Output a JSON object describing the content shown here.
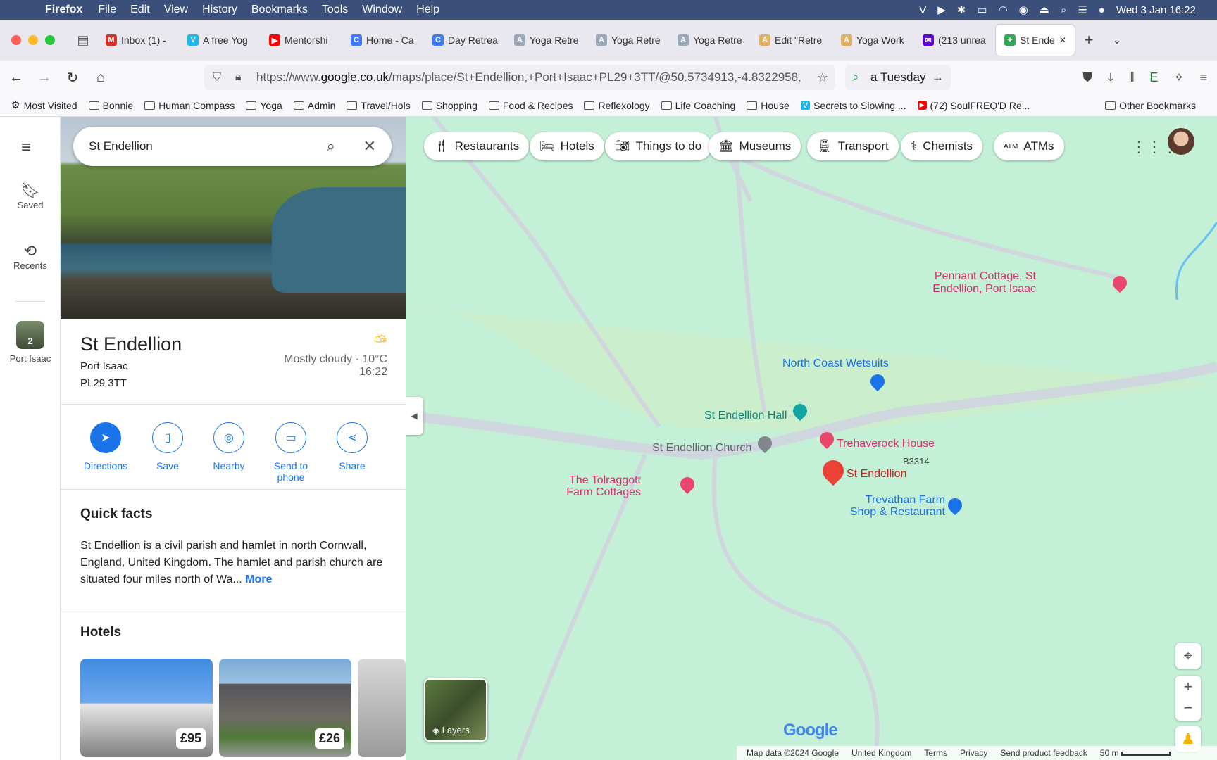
{
  "menubar": {
    "app": "Firefox",
    "items": [
      "File",
      "Edit",
      "View",
      "History",
      "Bookmarks",
      "Tools",
      "Window",
      "Help"
    ],
    "clock": "Wed 3 Jan  16:22"
  },
  "tabs": [
    {
      "label": "Inbox (1) -",
      "color": "#d93025",
      "icon": "M"
    },
    {
      "label": "A free Yog",
      "color": "#1ab7ea",
      "icon": "V"
    },
    {
      "label": "Mentorshi",
      "color": "#ff0000",
      "icon": "▶"
    },
    {
      "label": "Home - Ca",
      "color": "#3c7bf2",
      "icon": "C"
    },
    {
      "label": "Day Retrea",
      "color": "#3c7bf2",
      "icon": "C"
    },
    {
      "label": "Yoga Retre",
      "color": "#9aa8b8",
      "icon": "A"
    },
    {
      "label": "Yoga Retre",
      "color": "#9aa8b8",
      "icon": "A"
    },
    {
      "label": "Yoga Retre",
      "color": "#9aa8b8",
      "icon": "A"
    },
    {
      "label": "Edit \"Retre",
      "color": "#e0b060",
      "icon": "A"
    },
    {
      "label": "Yoga Work",
      "color": "#e0b060",
      "icon": "A"
    },
    {
      "label": "(213 unrea",
      "color": "#6001d2",
      "icon": "✉"
    },
    {
      "label": "St Ende",
      "color": "#34a853",
      "icon": "⌖"
    }
  ],
  "url": {
    "prefix": "https://www.",
    "host": "google.co.uk",
    "path": "/maps/place/St+Endellion,+Port+Isaac+PL29+3TT/@50.5734913,-4.8322958,"
  },
  "tuesday": "a Tuesday",
  "bookmarks": [
    "Most Visited",
    "Bonnie",
    "Human Compass",
    "Yoga",
    "Admin",
    "Travel/Hols",
    "Shopping",
    "Food & Recipes",
    "Reflexology",
    "Life Coaching",
    "House",
    "Secrets to Slowing ...",
    "(72) SoulFREQ'D Re...",
    "Other Bookmarks"
  ],
  "rail": {
    "saved": "Saved",
    "recents": "Recents",
    "recent_place": "Port Isaac",
    "recent_count": "2"
  },
  "search": {
    "value": "St Endellion"
  },
  "place": {
    "name": "St Endellion",
    "line1": "Port Isaac",
    "line2": "PL29 3TT",
    "weather": "Mostly cloudy · 10°C",
    "time": "16:22"
  },
  "actions": [
    "Directions",
    "Save",
    "Nearby",
    "Send to\nphone",
    "Share"
  ],
  "quickfacts": {
    "title": "Quick facts",
    "text": "St Endellion is a civil parish and hamlet in north Cornwall, England, United Kingdom. The hamlet and parish church are situated four miles north of Wa...",
    "more": "More"
  },
  "hotels": {
    "title": "Hotels",
    "prices": [
      "£95",
      "£26"
    ]
  },
  "chips": [
    "Restaurants",
    "Hotels",
    "Things to do",
    "Museums",
    "Transport",
    "Chemists",
    "ATMs"
  ],
  "pois": {
    "pennant": "Pennant Cottage, St\nEndellion, Port Isaac",
    "wetsuits": "North Coast Wetsuits",
    "hall": "St Endellion Hall",
    "church": "St Endellion Church",
    "trehaverock": "Trehaverock House",
    "road": "B3314",
    "selected": "St Endellion",
    "tolraggott": "The Tolraggott\nFarm Cottages",
    "trevathan": "Trevathan Farm\nShop & Restaurant"
  },
  "layers": "Layers",
  "footer": {
    "mapdata": "Map data ©2024 Google",
    "country": "United Kingdom",
    "terms": "Terms",
    "privacy": "Privacy",
    "feedback": "Send product feedback",
    "scale": "50 m"
  },
  "logo": "Google"
}
